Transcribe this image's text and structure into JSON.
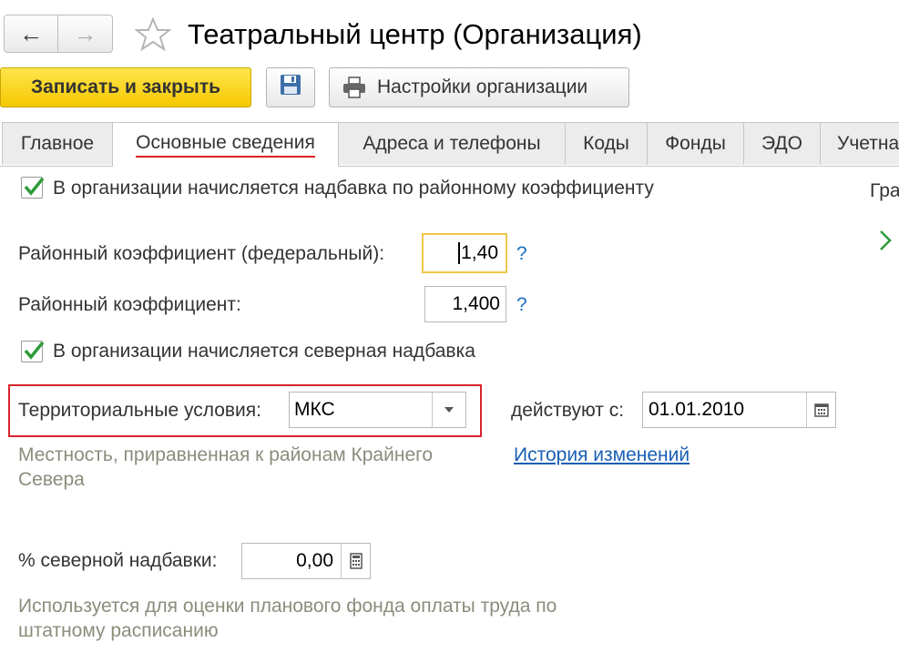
{
  "window": {
    "title": "Театральный центр (Организация)"
  },
  "toolbar": {
    "save_close_label": "Записать и закрыть",
    "org_settings_label": "Настройки организации"
  },
  "tabs": [
    {
      "label": "Главное"
    },
    {
      "label": "Основные сведения"
    },
    {
      "label": "Адреса и телефоны"
    },
    {
      "label": "Коды"
    },
    {
      "label": "Фонды"
    },
    {
      "label": "ЭДО"
    },
    {
      "label": "Учетна"
    }
  ],
  "form": {
    "regional_allowance_checkbox": {
      "label": "В организации начисляется надбавка по районному коэффициенту",
      "checked": true
    },
    "federal_coef": {
      "label": "Районный коэффициент (федеральный):",
      "value": "1,40",
      "help": "?"
    },
    "regional_coef": {
      "label": "Районный коэффициент:",
      "value": "1,400",
      "help": "?"
    },
    "northern_allowance_checkbox": {
      "label": "В организации начисляется северная надбавка",
      "checked": true
    },
    "territorial": {
      "label": "Территориальные условия:",
      "value": "МКС"
    },
    "effective_from": {
      "label": "действуют с:",
      "value": "01.01.2010"
    },
    "territorial_note": "Местность, приравненная к районам Крайнего Севера",
    "history_link": "История изменений",
    "northern_percent": {
      "label": "% северной надбавки:",
      "value": "0,00"
    },
    "northern_note": "Используется для оценки планового фонда оплаты труда по штатному расписанию"
  },
  "side": {
    "label": "Гра"
  },
  "colors": {
    "accent_yellow": "#f5c800",
    "highlight_red": "#d9232d",
    "check_green": "#2e9b3a",
    "link_blue": "#1a5fb4"
  }
}
